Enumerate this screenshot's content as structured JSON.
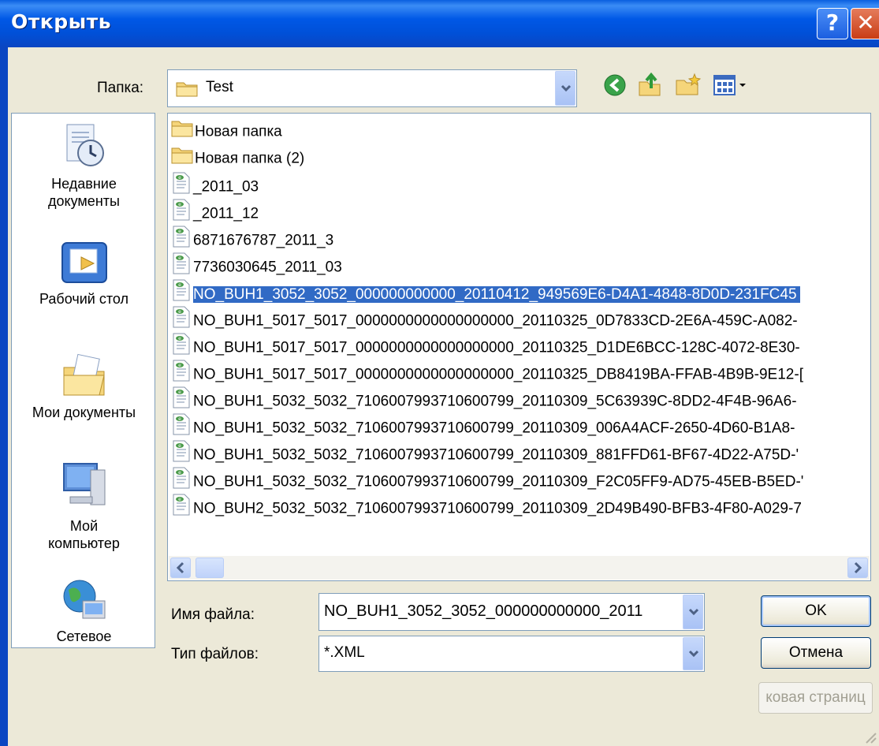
{
  "window": {
    "title": "Открыть"
  },
  "folder": {
    "label": "Папка:",
    "value": "Test"
  },
  "toolbar": {
    "icons": [
      "back-icon",
      "up-folder-icon",
      "new-folder-icon",
      "view-menu-icon"
    ]
  },
  "places": [
    {
      "label": "Недавние документы",
      "icon": "recent-documents-icon"
    },
    {
      "label": "Рабочий стол",
      "icon": "desktop-icon"
    },
    {
      "label": "Мои документы",
      "icon": "my-documents-icon"
    },
    {
      "label": "Мой компьютер",
      "icon": "my-computer-icon"
    },
    {
      "label": "Сетевое",
      "icon": "network-icon"
    }
  ],
  "files": [
    {
      "name": "Новая папка",
      "type": "folder"
    },
    {
      "name": "Новая папка (2)",
      "type": "folder"
    },
    {
      "name": "_2011_03",
      "type": "xml"
    },
    {
      "name": "_2011_12",
      "type": "xml"
    },
    {
      "name": "6871676787_2011_3",
      "type": "xml"
    },
    {
      "name": "7736030645_2011_03",
      "type": "xml"
    },
    {
      "name": "NO_BUH1_3052_3052_000000000000_20110412_949569E6-D4A1-4848-8D0D-231FC45",
      "type": "xml",
      "selected": true
    },
    {
      "name": "NO_BUH1_5017_5017_0000000000000000000_20110325_0D7833CD-2E6A-459C-A082-",
      "type": "xml"
    },
    {
      "name": "NO_BUH1_5017_5017_0000000000000000000_20110325_D1DE6BCC-128C-4072-8E30-",
      "type": "xml"
    },
    {
      "name": "NO_BUH1_5017_5017_0000000000000000000_20110325_DB8419BA-FFAB-4B9B-9E12-[",
      "type": "xml"
    },
    {
      "name": "NO_BUH1_5032_5032_7106007993710600799_20110309_5C63939C-8DD2-4F4B-96A6-",
      "type": "xml"
    },
    {
      "name": "NO_BUH1_5032_5032_7106007993710600799_20110309_006A4ACF-2650-4D60-B1A8-",
      "type": "xml"
    },
    {
      "name": "NO_BUH1_5032_5032_7106007993710600799_20110309_881FFD61-BF67-4D22-A75D-'",
      "type": "xml"
    },
    {
      "name": "NO_BUH1_5032_5032_7106007993710600799_20110309_F2C05FF9-AD75-45EB-B5ED-'",
      "type": "xml"
    },
    {
      "name": "NO_BUH2_5032_5032_7106007993710600799_20110309_2D49B490-BFB3-4F80-A029-7",
      "type": "xml"
    }
  ],
  "filename": {
    "label": "Имя файла:",
    "value": "NO_BUH1_3052_3052_000000000000_2011"
  },
  "filetype": {
    "label": "Тип файлов:",
    "value": "*.XML"
  },
  "buttons": {
    "ok": "OK",
    "cancel": "Отмена",
    "extra": "ковая страниц"
  }
}
